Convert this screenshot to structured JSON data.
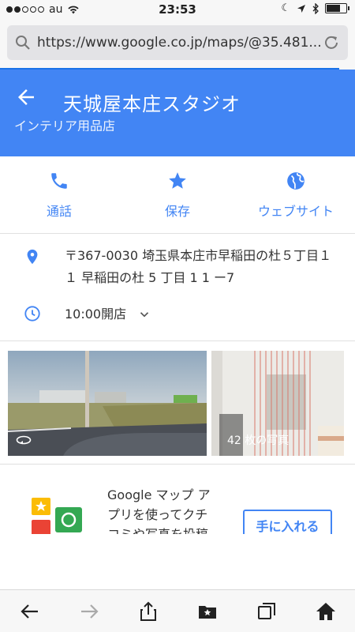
{
  "status_bar": {
    "carrier": "au",
    "time": "23:53",
    "battery_level": 0.7
  },
  "browser": {
    "url": "https://www.google.co.jp/maps/@35.481...",
    "accent_color": "#4285f4"
  },
  "place": {
    "title": "天城屋本庄スタジオ",
    "category": "インテリア用品店"
  },
  "actions": [
    {
      "label": "通話",
      "icon": "phone-icon"
    },
    {
      "label": "保存",
      "icon": "star-icon"
    },
    {
      "label": "ウェブサイト",
      "icon": "globe-icon"
    }
  ],
  "details": {
    "address": "〒367-0030 埼玉県本庄市早稲田の杜５丁目１１ 早稲田の杜 5 丁目 1 1 ー7",
    "hours": "10:00開店"
  },
  "photos": {
    "count_label": "42 枚の写真"
  },
  "promo": {
    "text": "Google マップ アプリを使ってクチコミや写真を投稿",
    "button": "手に入れる"
  }
}
